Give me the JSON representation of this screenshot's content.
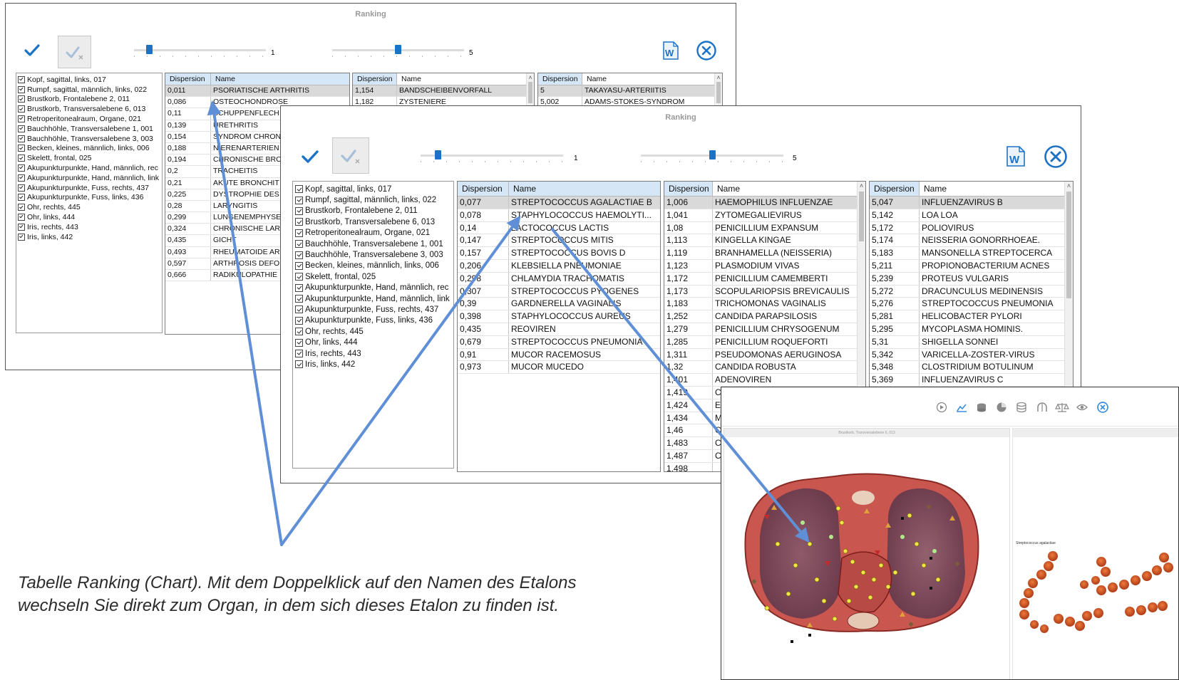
{
  "window1": {
    "title": "Ranking",
    "slider1_value": "1",
    "slider2_value": "5",
    "checklist": [
      "Kopf, sagittal, links, 017",
      "Rumpf, sagittal, männlich, links, 022",
      "Brustkorb, Frontalebene 2,  011",
      "Brustkorb, Transversalebene 6, 013",
      "Retroperitonealraum, Organe, 021",
      "Bauchhöhle, Transversalebene 1, 001",
      "Bauchhöhle, Transversalebene 3, 003",
      "Becken, kleines, männlich, links, 006",
      "Skelett, frontal, 025",
      "Akupunkturpunkte, Hand, männlich, rec",
      "Akupunkturpunkte, Hand, männlich, link",
      "Akupunkturpunkte, Fuss, rechts, 437",
      "Akupunkturpunkte, Fuss, links, 436",
      "Ohr, rechts, 445",
      "Ohr, links, 444",
      "Iris, rechts, 443",
      "Iris, links, 442"
    ],
    "table1": {
      "col_dispersion": "Dispersion",
      "col_name": "Name",
      "rows": [
        {
          "d": "0,011",
          "n": "PSORIATISCHE ARTHRITIS"
        },
        {
          "d": "0,086",
          "n": "OSTEOCHONDROSE"
        },
        {
          "d": "0,11",
          "n": "SCHUPPENFLECH"
        },
        {
          "d": "0,139",
          "n": "URETHRITIS"
        },
        {
          "d": "0,154",
          "n": "SYNDROM CHRON"
        },
        {
          "d": "0,188",
          "n": "NIERENARTERIEN"
        },
        {
          "d": "0,194",
          "n": "CHRONISCHE BRO"
        },
        {
          "d": "0,2",
          "n": "TRACHEITIS"
        },
        {
          "d": "0,21",
          "n": "AKUTE BRONCHIT"
        },
        {
          "d": "0,225",
          "n": "DYSTROPHIE DES"
        },
        {
          "d": "0,28",
          "n": "LARYNGITIS"
        },
        {
          "d": "0,299",
          "n": "LUNGENEMPHYSE"
        },
        {
          "d": "0,324",
          "n": "CHRONISCHE LAR"
        },
        {
          "d": "0,435",
          "n": "GICHT"
        },
        {
          "d": "0,493",
          "n": "RHEUMATOIDE AR"
        },
        {
          "d": "0,597",
          "n": "ARTHROSIS DEFO"
        },
        {
          "d": "0,666",
          "n": "RADIKULOPATHIE"
        }
      ]
    },
    "table2": {
      "col_dispersion": "Dispersion",
      "col_name": "Name",
      "rows": [
        {
          "d": "1,154",
          "n": "BANDSCHEIBENVORFALL"
        },
        {
          "d": "1,182",
          "n": "ZYSTENIERE"
        }
      ]
    },
    "table3": {
      "col_dispersion": "Dispersion",
      "col_name": "Name",
      "rows": [
        {
          "d": "5",
          "n": "TAKAYASU-ARTERIITIS"
        },
        {
          "d": "5,002",
          "n": "ADAMS-STOKES-SYNDROM"
        }
      ]
    }
  },
  "window2": {
    "title": "Ranking",
    "slider1_value": "1",
    "slider2_value": "5",
    "checklist": [
      "Kopf, sagittal, links, 017",
      "Rumpf, sagittal, männlich, links, 022",
      "Brustkorb, Frontalebene 2,  011",
      "Brustkorb, Transversalebene 6, 013",
      "Retroperitonealraum, Organe, 021",
      "Bauchhöhle, Transversalebene 1, 001",
      "Bauchhöhle, Transversalebene 3, 003",
      "Becken, kleines, männlich, links, 006",
      "Skelett, frontal, 025",
      "Akupunkturpunkte, Hand, männlich, rec",
      "Akupunkturpunkte, Hand, männlich, link",
      "Akupunkturpunkte, Fuss, rechts, 437",
      "Akupunkturpunkte, Fuss, links, 436",
      "Ohr, rechts, 445",
      "Ohr, links, 444",
      "Iris, rechts, 443",
      "Iris, links, 442"
    ],
    "table1": {
      "col_dispersion": "Dispersion",
      "col_name": "Name",
      "rows": [
        {
          "d": "0,077",
          "n": "STREPTOCOCCUS AGALACTIAE B"
        },
        {
          "d": "0,078",
          "n": "STAPHYLOCOCCUS HAEMOLYTI..."
        },
        {
          "d": "0,14",
          "n": "LACTOCOCCUS LACTIS"
        },
        {
          "d": "0,147",
          "n": "STREPTOCOCCUS MITIS"
        },
        {
          "d": "0,157",
          "n": "STREPTOCOCCUS BOVIS D"
        },
        {
          "d": "0,206",
          "n": "KLEBSIELLA PNEUMONIAE"
        },
        {
          "d": "0,298",
          "n": "CHLAMYDIA TRACHOMATIS"
        },
        {
          "d": "0,307",
          "n": "STREPTOCOCCUS PYOGENES"
        },
        {
          "d": "0,39",
          "n": "GARDNERELLA VAGINALIS"
        },
        {
          "d": "0,398",
          "n": "STAPHYLOCOCCUS AUREUS"
        },
        {
          "d": "0,435",
          "n": "REOVIREN"
        },
        {
          "d": "0,679",
          "n": "STREPTOCOCCUS PNEUMONIA"
        },
        {
          "d": "0,91",
          "n": "MUCOR RACEMOSUS"
        },
        {
          "d": "0,973",
          "n": "MUCOR MUCEDO"
        }
      ]
    },
    "table2": {
      "col_dispersion": "Dispersion",
      "col_name": "Name",
      "rows": [
        {
          "d": "1,006",
          "n": "HAEMOPHILUS INFLUENZAE"
        },
        {
          "d": "1,041",
          "n": "ZYTOMEGALIEVIRUS"
        },
        {
          "d": "1,08",
          "n": "PENICILLIUM EXPANSUM"
        },
        {
          "d": "1,113",
          "n": "KINGELLA KINGAE"
        },
        {
          "d": "1,119",
          "n": "BRANHAMELLA (NEISSERIA)"
        },
        {
          "d": "1,123",
          "n": "PLASMODIUM VIVAS"
        },
        {
          "d": "1,172",
          "n": "PENICILLIUM CAMEMBERTI"
        },
        {
          "d": "1,173",
          "n": "SCOPULARIOPSIS BREVICAULIS"
        },
        {
          "d": "1,183",
          "n": "TRICHOMONAS VAGINALIS"
        },
        {
          "d": "1,252",
          "n": "CANDIDA PARAPSILOSIS"
        },
        {
          "d": "1,279",
          "n": "PENICILLIUM CHRYSOGENUM"
        },
        {
          "d": "1,285",
          "n": "PENICILLIUM ROQUEFORTI"
        },
        {
          "d": "1,311",
          "n": "PSEUDOMONAS AERUGINOSA"
        },
        {
          "d": "1,32",
          "n": "CANDIDA ROBUSTA"
        },
        {
          "d": "1,401",
          "n": "ADENOVIREN"
        },
        {
          "d": "1,419",
          "n": "C"
        },
        {
          "d": "1,424",
          "n": "E"
        },
        {
          "d": "1,434",
          "n": "M"
        },
        {
          "d": "1,46",
          "n": "C"
        },
        {
          "d": "1,483",
          "n": "C"
        },
        {
          "d": "1,487",
          "n": "C"
        },
        {
          "d": "1,498",
          "n": ""
        }
      ]
    },
    "table3": {
      "col_dispersion": "Dispersion",
      "col_name": "Name",
      "rows": [
        {
          "d": "5,047",
          "n": "INFLUENZAVIRUS B"
        },
        {
          "d": "5,142",
          "n": "LOA LOA"
        },
        {
          "d": "5,172",
          "n": "POLIOVIRUS"
        },
        {
          "d": "5,174",
          "n": "NEISSERIA  GONORRHOEAE."
        },
        {
          "d": "5,183",
          "n": "MANSONELLA STREPTOCERCA"
        },
        {
          "d": "5,211",
          "n": "PROPIONOBACTERIUM ACNES"
        },
        {
          "d": "5,239",
          "n": "PROTEUS VULGARIS"
        },
        {
          "d": "5,272",
          "n": "DRACUNCULUS MEDINENSIS"
        },
        {
          "d": "5,276",
          "n": "STREPTOCOCCUS  PNEUMONIA"
        },
        {
          "d": "5,281",
          "n": "HELICOBACTER PYLORI"
        },
        {
          "d": "5,295",
          "n": "MYCOPLASMA HOMINIS."
        },
        {
          "d": "5,31",
          "n": "SHIGELLA SONNEI"
        },
        {
          "d": "5,342",
          "n": "VARICELLA-ZOSTER-VIRUS"
        },
        {
          "d": "5,348",
          "n": "CLOSTRIDIUM BOTULINUM"
        },
        {
          "d": "5,369",
          "n": "INFLUENZAVIRUS C"
        }
      ]
    }
  },
  "organ_window": {
    "image_title": "Brustkorb, Transversalebene 6, 013",
    "side_label": "Streptococcus agalactiae"
  },
  "caption": {
    "line1": "Tabelle Ranking (Chart). Mit dem Doppelklick auf den Namen des Etalons",
    "line2": "wechseln Sie direkt zum Organ, in dem sich dieses Etalon zu finden ist."
  },
  "icons": {
    "confirm": "checkmark-icon",
    "uncheck_all": "uncheck-all-icon",
    "word_export": "word-document-icon",
    "close": "close-circle-icon",
    "organ_toolbar": [
      "play-icon",
      "chart-icon",
      "layers-icon",
      "pie-icon",
      "database-icon",
      "brain-icon",
      "scales-icon",
      "eye-icon",
      "close-circle-icon"
    ]
  },
  "colors": {
    "accent_blue": "#1c72c4",
    "header_blue": "#d5e7f7",
    "arrow_blue": "#5f8fd6",
    "selected_row": "#d9d9d9"
  }
}
